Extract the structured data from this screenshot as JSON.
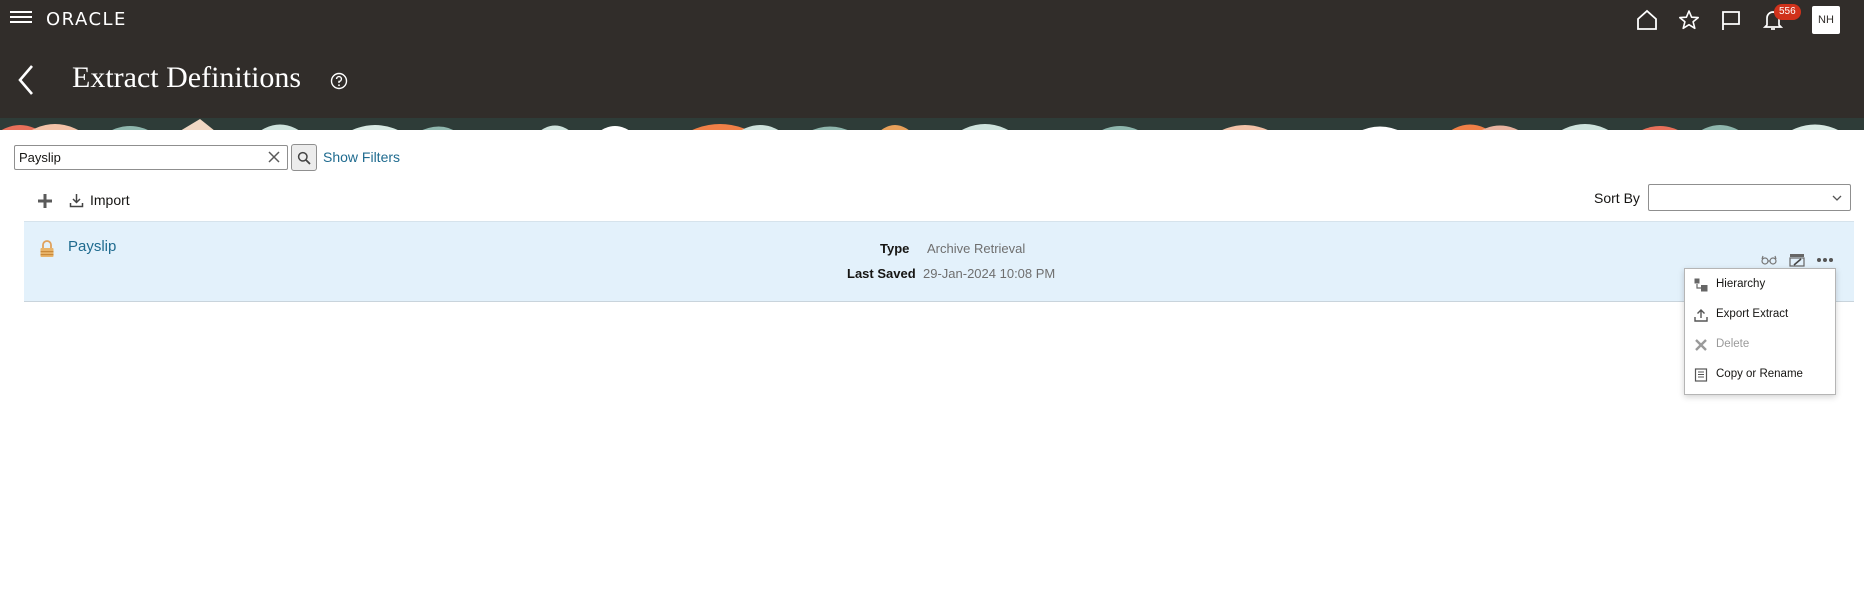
{
  "header": {
    "brand": "ORACLE",
    "notification_count": "556",
    "user_initials": "NH",
    "page_title": "Extract Definitions"
  },
  "search": {
    "value": "Payslip",
    "show_filters_label": "Show Filters"
  },
  "toolbar": {
    "import_label": "Import",
    "sort_label": "Sort By",
    "sort_value": ""
  },
  "results": [
    {
      "name": "Payslip",
      "type_label": "Type",
      "type_value": "Archive Retrieval",
      "last_saved_label": "Last Saved",
      "last_saved_value": "29-Jan-2024 10:08 PM"
    }
  ],
  "actions_menu": {
    "items": [
      {
        "label": "Hierarchy",
        "icon": "hierarchy-icon",
        "enabled": true
      },
      {
        "label": "Export Extract",
        "icon": "export-icon",
        "enabled": true
      },
      {
        "label": "Delete",
        "icon": "delete-icon",
        "enabled": false
      },
      {
        "label": "Copy or Rename",
        "icon": "copy-icon",
        "enabled": true
      }
    ]
  },
  "colors": {
    "header_bg": "#312d2a",
    "link": "#1f6b8f",
    "row_bg": "#e3f1fb",
    "badge": "#d0321b"
  }
}
